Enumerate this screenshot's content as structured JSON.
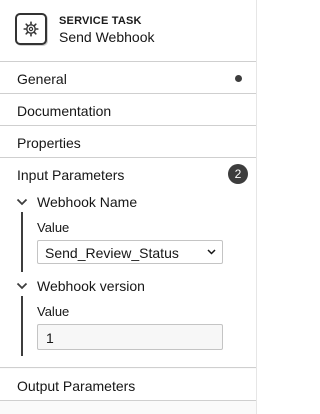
{
  "header": {
    "type": "SERVICE TASK",
    "name": "Send Webhook",
    "icon": "gear-icon"
  },
  "groups": {
    "general": {
      "label": "General",
      "indicator": "dot"
    },
    "documentation": {
      "label": "Documentation"
    },
    "properties": {
      "label": "Properties"
    },
    "input_parameters": {
      "label": "Input Parameters",
      "count": "2",
      "items": [
        {
          "title": "Webhook Name",
          "field_label": "Value",
          "field_type": "select",
          "field_value": "Send_Review_Status"
        },
        {
          "title": "Webhook version",
          "field_label": "Value",
          "field_type": "text",
          "field_value": "1"
        }
      ]
    },
    "output_parameters": {
      "label": "Output Parameters"
    }
  },
  "colors": {
    "badge": "#3d3d3d",
    "divider": "#cfcfcf",
    "text": "#161616"
  }
}
